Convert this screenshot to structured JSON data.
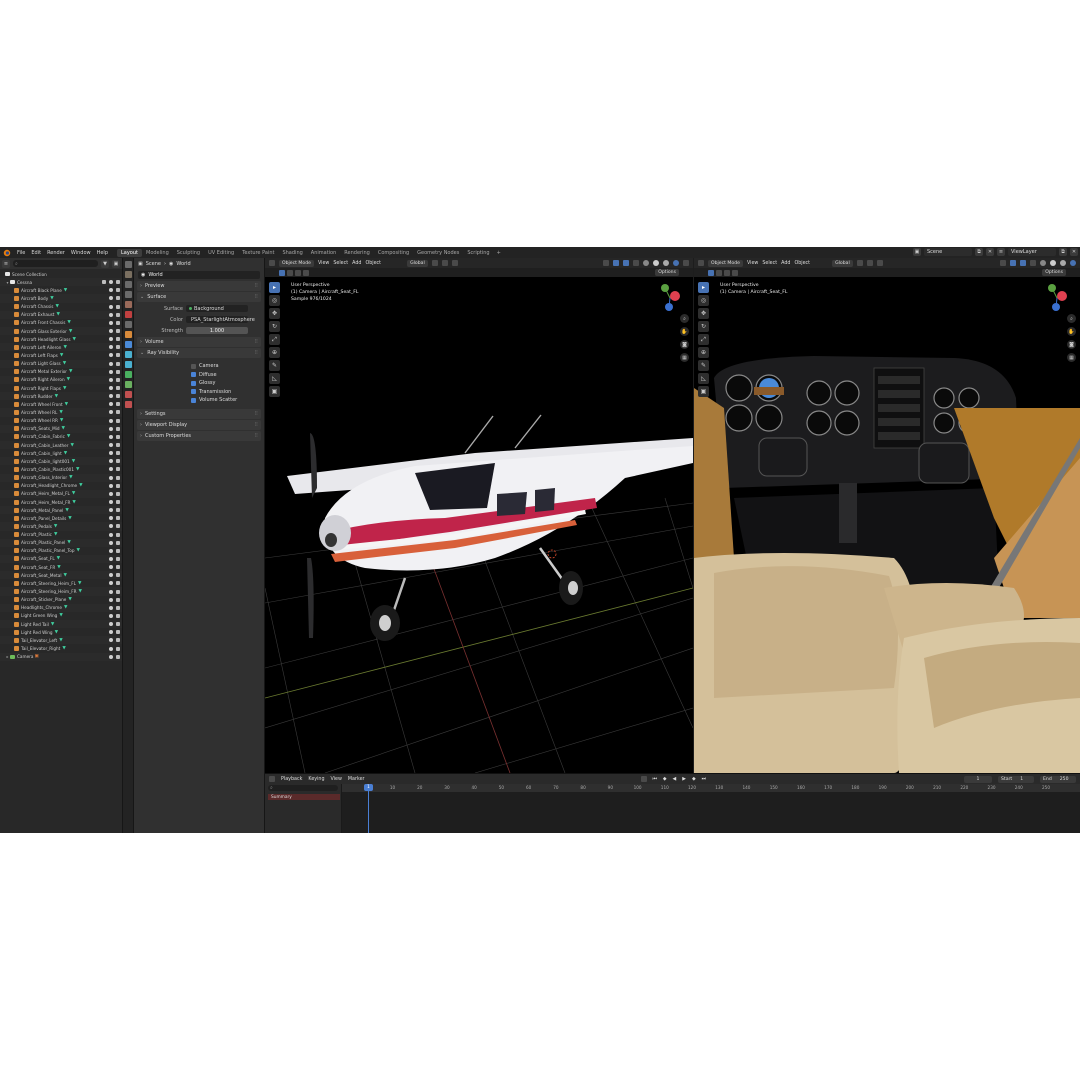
{
  "menu": [
    "File",
    "Edit",
    "Render",
    "Window",
    "Help"
  ],
  "workspaces": [
    "Layout",
    "Modeling",
    "Sculpting",
    "UV Editing",
    "Texture Paint",
    "Shading",
    "Animation",
    "Rendering",
    "Compositing",
    "Geometry Nodes",
    "Scripting"
  ],
  "active_workspace": "Layout",
  "top_right": {
    "scene": "Scene",
    "view_layer": "ViewLayer"
  },
  "outliner": {
    "root": "Scene Collection",
    "collection": "Cessna",
    "items": [
      "Aircraft Black Plane",
      "Aircraft Body",
      "Aircraft Chassis",
      "Aircraft Exhaust",
      "Aircraft Front Chassis",
      "Aircraft Glass Exterior",
      "Aircraft Headlight Glass",
      "Aircraft Left Aileron",
      "Aircraft Left Flaps",
      "Aircraft Light Glass",
      "Aircraft Metal Exterior",
      "Aircraft Right Aileron",
      "Aircraft Right Flaps",
      "Aircraft Rudder",
      "Aircraft Wheel Front",
      "Aircraft Wheel RL",
      "Aircraft Wheel RR",
      "Aircraft_Seats_Mid",
      "Aircraft_Cabin_Fabric",
      "Aircraft_Cabin_Leather",
      "Aircraft_Cabin_light",
      "Aircraft_Cabin_light001",
      "Aircraft_Cabin_Plastic001",
      "Aircraft_Glass_Interior",
      "Aircraft_Headlight_Chrome",
      "Aircraft_Heim_Metal_FL",
      "Aircraft_Heim_Metal_FR",
      "Aircraft_Metal_Panel",
      "Aircraft_Panel_Details",
      "Aircraft_Pedals",
      "Aircraft_Plastic",
      "Aircraft_Plastic_Panel",
      "Aircraft_Plastic_Panel_Top",
      "Aircraft_Seat_FL",
      "Aircraft_Seat_FR",
      "Aircraft_Seat_Metal",
      "Aircraft_Steering_Heim_FL",
      "Aircraft_Steering_Heim_FR",
      "Aircraft_Sticker_Plane",
      "Headlights_Chrome",
      "Light Green Wing",
      "Light Red Tail",
      "Light Red Wing",
      "Tail_Elevator_Left",
      "Tail_Elevator_Right"
    ],
    "camera": "Camera"
  },
  "properties": {
    "breadcrumb_scene": "Scene",
    "breadcrumb_world": "World",
    "world_name": "World",
    "sections": {
      "preview": "Preview",
      "surface": "Surface",
      "volume": "Volume",
      "ray_visibility": "Ray Visibility",
      "settings": "Settings",
      "viewport_display": "Viewport Display",
      "custom_properties": "Custom Properties"
    },
    "surface_label": "Surface",
    "surface_value": "Background",
    "color_label": "Color",
    "color_value": "PSA_StarlightAtmosphere",
    "strength_label": "Strength",
    "strength_value": "1.000",
    "ray_options": [
      "Camera",
      "Diffuse",
      "Glossy",
      "Transmission",
      "Volume Scatter"
    ],
    "ray_checked": [
      false,
      true,
      true,
      true,
      true
    ]
  },
  "viewport_left": {
    "mode": "Object Mode",
    "menus": [
      "View",
      "Select",
      "Add",
      "Object"
    ],
    "orientation": "Global",
    "options": "Options",
    "info": [
      "User Perspective",
      "(1) Camera | Aircraft_Seat_FL",
      "Sample 976/1024"
    ]
  },
  "viewport_right": {
    "mode": "Object Mode",
    "menus": [
      "View",
      "Select",
      "Add",
      "Object"
    ],
    "orientation": "Global",
    "options": "Options",
    "info": [
      "User Perspective",
      "(1) Camera | Aircraft_Seat_FL"
    ]
  },
  "timeline": {
    "menus": [
      "Playback",
      "Keying",
      "View",
      "Marker"
    ],
    "current_frame": "1",
    "start_label": "Start",
    "start": "1",
    "end_label": "End",
    "end": "250",
    "summary": "Summary",
    "ticks": [
      "10",
      "20",
      "30",
      "40",
      "50",
      "60",
      "70",
      "80",
      "90",
      "100",
      "110",
      "120",
      "130",
      "140",
      "150",
      "160",
      "170",
      "180",
      "190",
      "200",
      "210",
      "220",
      "230",
      "240",
      "250"
    ]
  }
}
